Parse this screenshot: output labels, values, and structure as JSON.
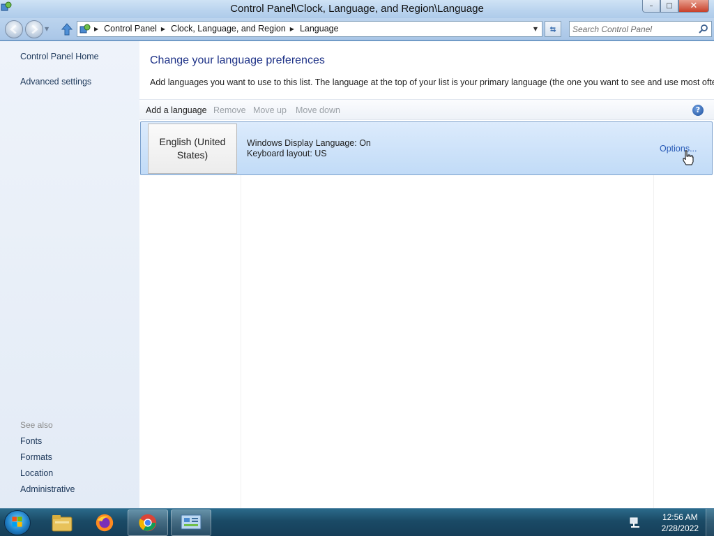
{
  "window": {
    "title": "Control Panel\\Clock, Language, and Region\\Language",
    "minimize": "–",
    "maximize": "□",
    "close": "✕"
  },
  "navbar": {
    "breadcrumbs": [
      "Control Panel",
      "Clock, Language, and Region",
      "Language"
    ],
    "search_placeholder": "Search Control Panel"
  },
  "sidebar": {
    "links": [
      "Control Panel Home",
      "Advanced settings"
    ],
    "see_also_label": "See also",
    "see_also": [
      "Fonts",
      "Formats",
      "Location",
      "Administrative"
    ]
  },
  "main": {
    "title": "Change your language preferences",
    "description": "Add languages you want to use to this list. The language at the top of your list is your primary language (the one you want to see and use most often).",
    "toolbar": {
      "add": "Add a language",
      "remove": "Remove",
      "move_up": "Move up",
      "move_down": "Move down",
      "help": "?"
    },
    "languages": [
      {
        "name": "English (United States)",
        "display_language": "Windows Display Language: On",
        "keyboard": "Keyboard layout: US",
        "options": "Options..."
      }
    ]
  },
  "taskbar": {
    "apps": [
      "file-explorer-icon",
      "firefox-icon",
      "chrome-icon",
      "control-panel-icon"
    ],
    "time": "12:56 AM",
    "date": "2/28/2022"
  },
  "colors": {
    "link": "#1e395b",
    "title": "#1e3287",
    "selection": "#c1dbf7",
    "options_link": "#2a5cb8"
  }
}
